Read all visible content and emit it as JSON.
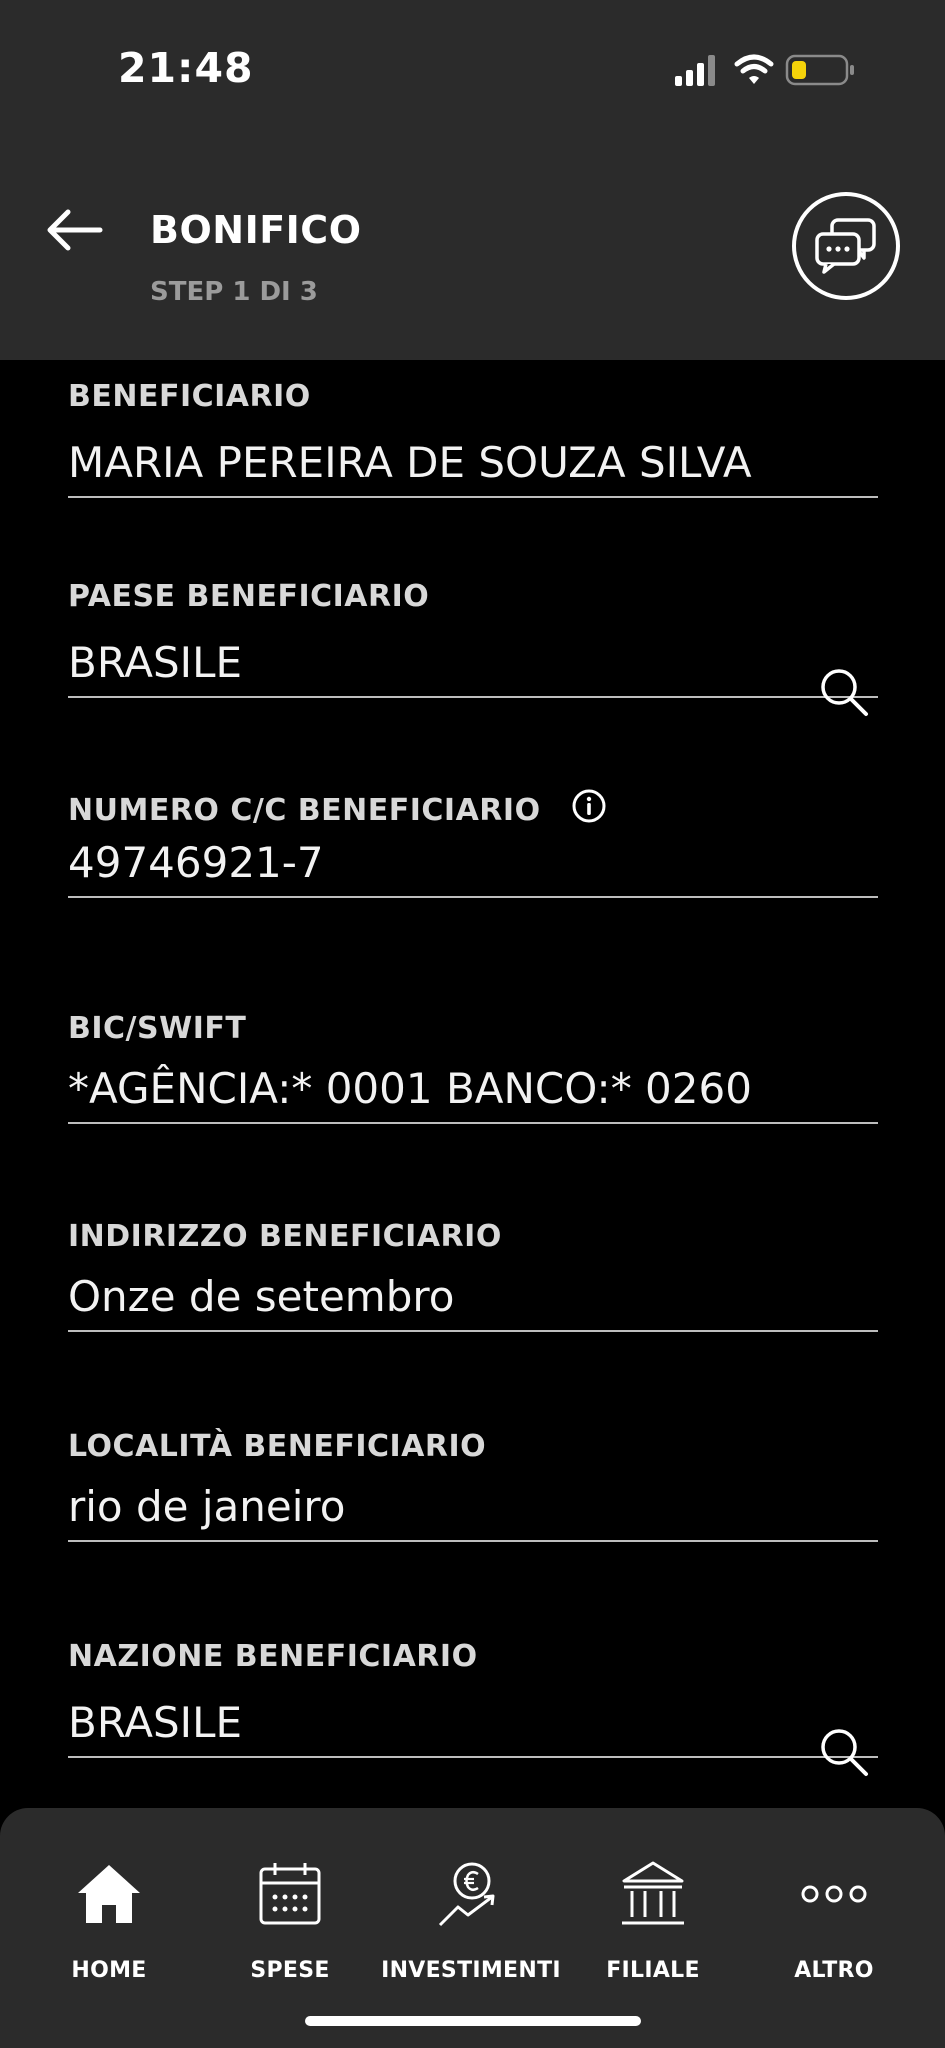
{
  "status": {
    "time": "21:48"
  },
  "header": {
    "title": "BONIFICO",
    "subtitle": "STEP 1 DI 3"
  },
  "form": {
    "fields": [
      {
        "label": "BENEFICIARIO",
        "value": "MARIA PEREIRA DE SOUZA SILVA"
      },
      {
        "label": "PAESE BENEFICIARIO",
        "value": "BRASILE",
        "icon": "search-icon"
      },
      {
        "label": "NUMERO C/C BENEFICIARIO",
        "value": "49746921-7",
        "icon": "info-icon"
      },
      {
        "label": "BIC/SWIFT",
        "value": "*AGÊNCIA:* 0001 BANCO:* 0260"
      },
      {
        "label": "INDIRIZZO BENEFICIARIO",
        "value": "Onze de setembro"
      },
      {
        "label": "LOCALITÀ BENEFICIARIO",
        "value": "rio de janeiro"
      },
      {
        "label": "NAZIONE BENEFICIARIO",
        "value": "BRASILE",
        "icon": "search-icon"
      }
    ]
  },
  "nav": {
    "items": [
      {
        "label": "HOME",
        "icon": "home-icon"
      },
      {
        "label": "SPESE",
        "icon": "calendar-icon"
      },
      {
        "label": "INVESTIMENTI",
        "icon": "euro-growth-icon"
      },
      {
        "label": "FILIALE",
        "icon": "bank-icon"
      },
      {
        "label": "ALTRO",
        "icon": "more-dots-icon"
      }
    ]
  }
}
